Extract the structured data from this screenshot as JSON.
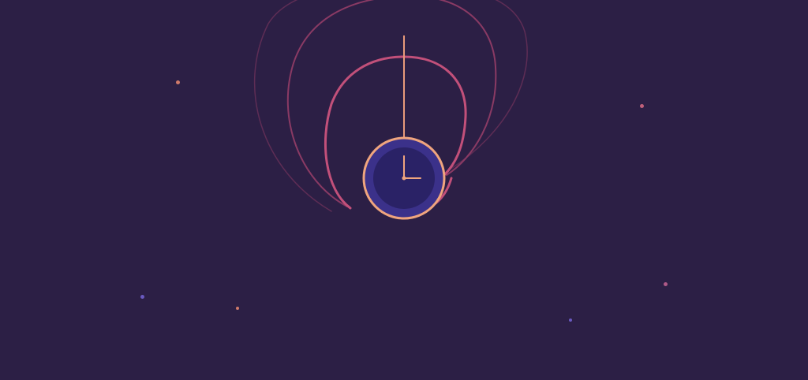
{
  "colors": {
    "background": "#2c1f45",
    "swirl_bright": "#c2507a",
    "swirl_mid": "#8a3a64",
    "swirl_dim": "#5e2d55",
    "pendulum_string": "#e89a7a",
    "clock_rim": "#f0a57e",
    "clock_face_outer": "#3b318a",
    "clock_face_inner": "#2a2266",
    "clock_hands": "#f0a57e"
  },
  "stars": [
    {
      "color": "#d07a6a"
    },
    {
      "color": "#c0607a"
    },
    {
      "color": "#6a5ac0"
    },
    {
      "color": "#d07a6a"
    },
    {
      "color": "#b05a88"
    },
    {
      "color": "#6a5ac0"
    }
  ],
  "clock": {
    "icon": "clock-icon",
    "hour_hand_direction": "12",
    "minute_hand_direction": "3"
  }
}
